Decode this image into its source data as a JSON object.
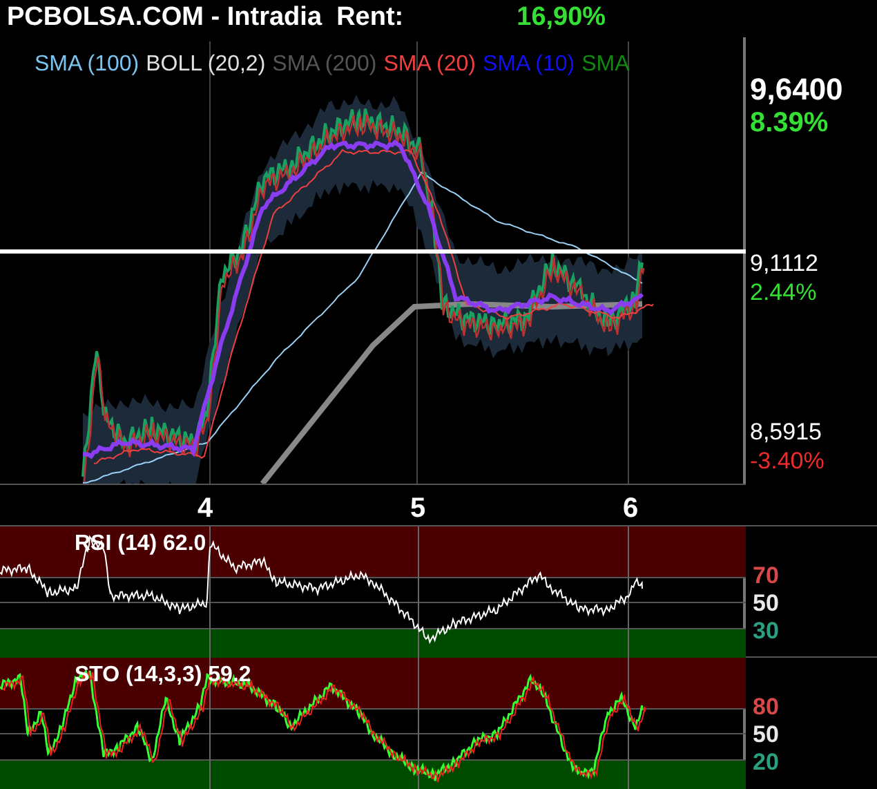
{
  "header": {
    "title": "PCBOLSA.COM - Intradia  Rent:",
    "return": "16,90%"
  },
  "legend": [
    {
      "label": "SMA (100)",
      "color": "#7cc4f0"
    },
    {
      "label": "BOLL (20,2)",
      "color": "#e0e0e0"
    },
    {
      "label": "SMA (200)",
      "color": "#555555"
    },
    {
      "label": "SMA (20)",
      "color": "#ee4040"
    },
    {
      "label": "SMA (10)",
      "color": "#1010f0"
    },
    {
      "label": "SMA",
      "color": "#0e8a0e"
    }
  ],
  "price_axis": [
    {
      "kind": "current",
      "price": "9,6400",
      "change": "8.39%",
      "color": "#33e033"
    },
    {
      "kind": "level",
      "price": "9,1112",
      "change": "2.44%",
      "color": "#33e033"
    },
    {
      "kind": "level",
      "price": "8,5915",
      "change": "-3.40%",
      "color": "#ee2a2a"
    }
  ],
  "x_axis": [
    "4",
    "5",
    "6"
  ],
  "indicators": [
    {
      "kind": "rsi",
      "label": "RSI (14) 62.0",
      "levels": [
        {
          "label": "70",
          "color": "#d84848"
        },
        {
          "label": "50",
          "color": "#e8e8e8"
        },
        {
          "label": "30",
          "color": "#2aa080"
        }
      ]
    },
    {
      "kind": "sto",
      "label": "STO (14,3,3) 59.2",
      "levels": [
        {
          "label": "80",
          "color": "#d84848"
        },
        {
          "label": "50",
          "color": "#e8e8e8"
        },
        {
          "label": "20",
          "color": "#2aa080"
        }
      ]
    }
  ]
}
